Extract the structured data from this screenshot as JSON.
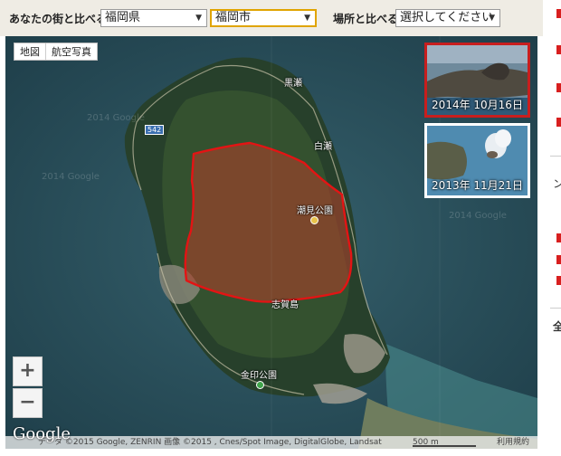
{
  "compare": {
    "town_label": "あなたの街と比べる",
    "prefecture": "福岡県",
    "city": "福岡市",
    "place_label": "場所と比べる",
    "place_select": "選択してください"
  },
  "map": {
    "type_controls": [
      "地図",
      "航空写真"
    ],
    "zoom_in": "+",
    "zoom_out": "−",
    "road_number": "542",
    "labels": {
      "kurose": "黒瀬",
      "shirose": "白瀬",
      "shiomi_park": "潮見公園",
      "shikashima": "志賀島",
      "kinin_park": "金印公園"
    },
    "watermark": "2014 Google",
    "thumbnails": [
      {
        "caption": "2014年 10月16日",
        "border": "#c81e1e"
      },
      {
        "caption": "2013年 11月21日",
        "border": "#ffffff"
      }
    ],
    "google_logo": "Google",
    "attribution": "データ ©2015 Google, ZENRIN 画像 ©2015 , Cnes/Spot Image, DigitalGlobe, Landsat",
    "scale": "500 m",
    "terms": "利用規約",
    "overlay_color": "#e31414"
  },
  "right_column": {
    "item_small": "ン",
    "item_heading": "全"
  }
}
